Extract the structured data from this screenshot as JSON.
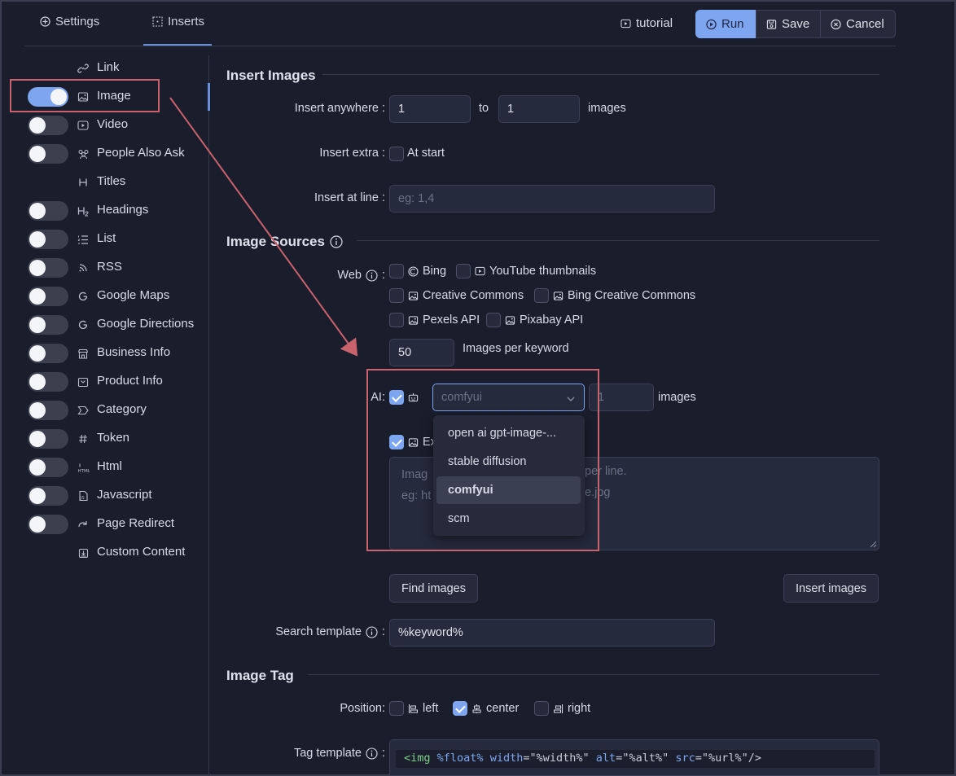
{
  "tabs": {
    "settings": "Settings",
    "inserts": "Inserts"
  },
  "toolbar": {
    "tutorial": "tutorial",
    "run": "Run",
    "save": "Save",
    "cancel": "Cancel"
  },
  "sidebar": {
    "items": [
      {
        "label": "Link",
        "toggle": null,
        "icon": "link-icon"
      },
      {
        "label": "Image",
        "toggle": true,
        "icon": "image-icon"
      },
      {
        "label": "Video",
        "toggle": false,
        "icon": "video-icon"
      },
      {
        "label": "People Also Ask",
        "toggle": false,
        "icon": "people-icon"
      },
      {
        "label": "Titles",
        "toggle": null,
        "icon": "heading-icon"
      },
      {
        "label": "Headings",
        "toggle": false,
        "icon": "heading2-icon"
      },
      {
        "label": "List",
        "toggle": false,
        "icon": "list-icon"
      },
      {
        "label": "RSS",
        "toggle": false,
        "icon": "rss-icon"
      },
      {
        "label": "Google Maps",
        "toggle": false,
        "icon": "google-icon"
      },
      {
        "label": "Google Directions",
        "toggle": false,
        "icon": "google-icon"
      },
      {
        "label": "Business Info",
        "toggle": false,
        "icon": "store-icon"
      },
      {
        "label": "Product Info",
        "toggle": false,
        "icon": "product-icon"
      },
      {
        "label": "Category",
        "toggle": false,
        "icon": "category-icon"
      },
      {
        "label": "Token",
        "toggle": false,
        "icon": "hash-icon"
      },
      {
        "label": "Html",
        "toggle": false,
        "icon": "html-icon"
      },
      {
        "label": "Javascript",
        "toggle": false,
        "icon": "javascript-icon"
      },
      {
        "label": "Page Redirect",
        "toggle": false,
        "icon": "redirect-icon"
      },
      {
        "label": "Custom Content",
        "toggle": null,
        "icon": "custom-content-icon"
      }
    ]
  },
  "insert_images": {
    "title": "Insert Images",
    "anywhere_label": "Insert anywhere",
    "anywhere_from": "1",
    "to_label": "to",
    "anywhere_to": "1",
    "images_label": "images",
    "extra_label": "Insert extra",
    "at_start_label": "At start",
    "at_line_label": "Insert at line",
    "at_line_placeholder": "eg: 1,4"
  },
  "image_sources": {
    "title": "Image Sources",
    "web_label": "Web",
    "bing": "Bing",
    "youtube": "YouTube thumbnails",
    "creative_commons": "Creative Commons",
    "bing_cc": "Bing Creative Commons",
    "pexels": "Pexels API",
    "pixabay": "Pixabay API",
    "per_keyword_value": "50",
    "per_keyword_label": "Images per keyword",
    "ai_label": "AI",
    "ai_select_value": "comfyui",
    "ai_count": "1",
    "ai_images_label": "images",
    "external_label": "Ex",
    "textarea_line1": "Imag",
    "textarea_line1b": "per line.",
    "textarea_line2": "eg: ht",
    "textarea_line2b": "e.jpg",
    "dropdown_options": [
      "open ai gpt-image-...",
      "stable diffusion",
      "comfyui",
      "scm"
    ],
    "find_images": "Find images",
    "insert_images": "Insert images",
    "search_template_label": "Search template",
    "search_template_value": "%keyword%"
  },
  "image_tag": {
    "title": "Image Tag",
    "position_label": "Position",
    "left": "left",
    "center": "center",
    "right": "right",
    "tag_template_label": "Tag template",
    "code_tag": "<img",
    "code_float": "%float%",
    "code_width_attr": "width",
    "code_width_val": "\"%width%\"",
    "code_alt_attr": "alt",
    "code_alt_val": "\"%alt%\"",
    "code_src_attr": "src",
    "code_src_val": "\"%url%\"",
    "code_close": "/>"
  },
  "colors": {
    "accent": "#7ea5f0",
    "annotation": "#c9626c",
    "background": "#1a1d2c"
  }
}
